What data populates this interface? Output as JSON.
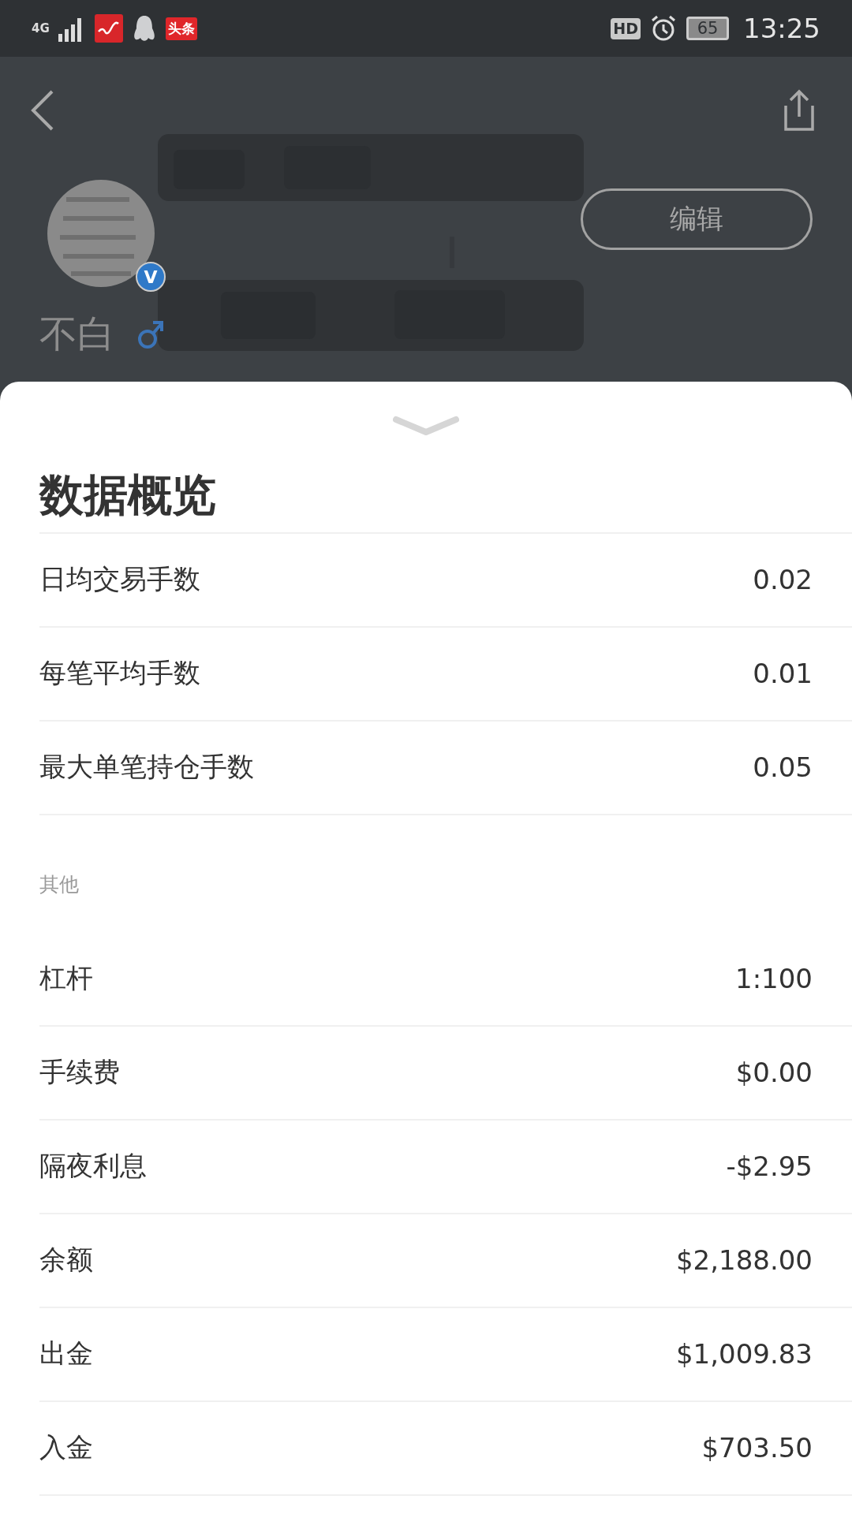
{
  "status_bar": {
    "network": "4G",
    "app_badge": "头条",
    "hd": "HD",
    "battery": "65",
    "time": "13:25"
  },
  "profile": {
    "verified_badge": "V",
    "edit_button": "编辑",
    "name": "不白"
  },
  "sheet": {
    "title": "数据概览",
    "rows": [
      {
        "label": "日均交易手数",
        "value": "0.02"
      },
      {
        "label": "每笔平均手数",
        "value": "0.01"
      },
      {
        "label": "最大单笔持仓手数",
        "value": "0.05"
      }
    ],
    "other": {
      "label": "其他",
      "rows": [
        {
          "label": "杠杆",
          "value": "1:100"
        },
        {
          "label": "手续费",
          "value": "$0.00"
        },
        {
          "label": "隔夜利息",
          "value": "-$2.95"
        },
        {
          "label": "余额",
          "value": "$2,188.00"
        },
        {
          "label": "出金",
          "value": "$1,009.83"
        },
        {
          "label": "入金",
          "value": "$703.50"
        }
      ]
    }
  }
}
